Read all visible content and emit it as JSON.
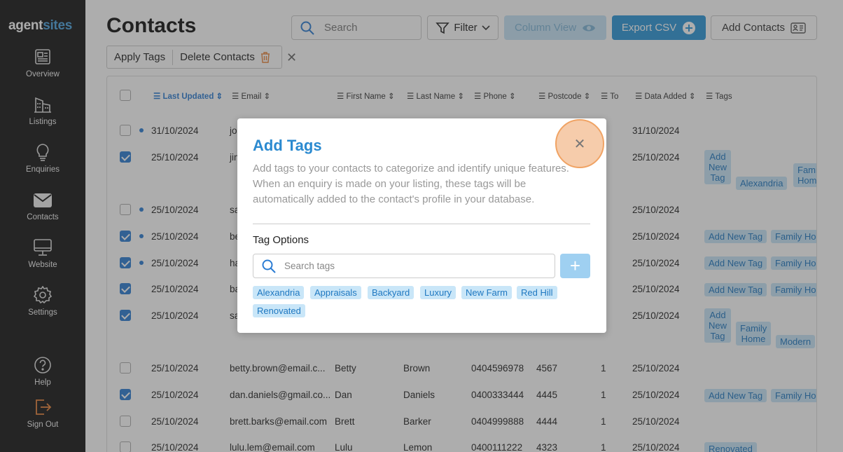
{
  "brand": {
    "part1": "agent",
    "part2": "sites"
  },
  "sidebar": {
    "items": [
      {
        "label": "Overview",
        "icon": "newspaper-icon"
      },
      {
        "label": "Listings",
        "icon": "buildings-icon"
      },
      {
        "label": "Enquiries",
        "icon": "lightbulb-icon"
      },
      {
        "label": "Contacts",
        "icon": "envelope-icon"
      },
      {
        "label": "Website",
        "icon": "monitor-icon"
      },
      {
        "label": "Settings",
        "icon": "gear-icon"
      }
    ],
    "bottom": [
      {
        "label": "Help",
        "icon": "help-icon"
      },
      {
        "label": "Sign Out",
        "icon": "sign-out-icon"
      }
    ]
  },
  "header": {
    "title": "Contacts",
    "search_placeholder": "Search",
    "filter_label": "Filter",
    "column_view_label": "Column View",
    "export_label": "Export CSV",
    "add_contacts_label": "Add Contacts"
  },
  "actions": {
    "apply_tags": "Apply Tags",
    "delete_contacts": "Delete Contacts"
  },
  "table": {
    "columns": [
      "Last Updated",
      "Email",
      "First Name",
      "Last Name",
      "Phone",
      "Postcode",
      "To",
      "Data Added",
      "Tags"
    ],
    "rows": [
      {
        "checked": false,
        "dot": true,
        "updated": "31/10/2024",
        "email": "jo",
        "first": "",
        "last": "",
        "phone": "",
        "postcode": "",
        "to": "",
        "added": "31/10/2024",
        "tags": []
      },
      {
        "checked": true,
        "dot": false,
        "updated": "25/10/2024",
        "email": "jin",
        "first": "",
        "last": "",
        "phone": "",
        "postcode": "",
        "to": "",
        "added": "25/10/2024",
        "tags": [
          "Add New Tag",
          "Alexandria",
          "Family Home"
        ]
      },
      {
        "checked": false,
        "dot": true,
        "updated": "25/10/2024",
        "email": "sa",
        "first": "",
        "last": "",
        "phone": "",
        "postcode": "",
        "to": "",
        "added": "25/10/2024",
        "tags": []
      },
      {
        "checked": true,
        "dot": true,
        "updated": "25/10/2024",
        "email": "be",
        "first": "",
        "last": "",
        "phone": "",
        "postcode": "",
        "to": "",
        "added": "25/10/2024",
        "tags": [
          "Add New Tag",
          "Family Home"
        ]
      },
      {
        "checked": true,
        "dot": true,
        "updated": "25/10/2024",
        "email": "ha",
        "first": "",
        "last": "",
        "phone": "",
        "postcode": "",
        "to": "",
        "added": "25/10/2024",
        "tags": [
          "Add New Tag",
          "Family Home"
        ]
      },
      {
        "checked": true,
        "dot": false,
        "updated": "25/10/2024",
        "email": "ba",
        "first": "",
        "last": "",
        "phone": "",
        "postcode": "",
        "to": "",
        "added": "25/10/2024",
        "tags": [
          "Add New Tag",
          "Family Home"
        ]
      },
      {
        "checked": true,
        "dot": false,
        "updated": "25/10/2024",
        "email": "sa",
        "first": "",
        "last": "",
        "phone": "",
        "postcode": "",
        "to": "",
        "added": "25/10/2024",
        "tags": [
          "Add New Tag",
          "Family Home",
          "Modern"
        ]
      },
      {
        "checked": false,
        "dot": false,
        "updated": "25/10/2024",
        "email": "betty.brown@email.c...",
        "first": "Betty",
        "last": "Brown",
        "phone": "0404596978",
        "postcode": "4567",
        "to": "1",
        "added": "25/10/2024",
        "tags": []
      },
      {
        "checked": true,
        "dot": false,
        "updated": "25/10/2024",
        "email": "dan.daniels@gmail.co...",
        "first": "Dan",
        "last": "Daniels",
        "phone": "0400333444",
        "postcode": "4445",
        "to": "1",
        "added": "25/10/2024",
        "tags": [
          "Add New Tag",
          "Family Home"
        ]
      },
      {
        "checked": false,
        "dot": false,
        "updated": "25/10/2024",
        "email": "brett.barks@email.com",
        "first": "Brett",
        "last": "Barker",
        "phone": "0404999888",
        "postcode": "4444",
        "to": "1",
        "added": "25/10/2024",
        "tags": []
      },
      {
        "checked": false,
        "dot": false,
        "updated": "25/10/2024",
        "email": "lulu.lem@email.com",
        "first": "Lulu",
        "last": "Lemon",
        "phone": "0400111222",
        "postcode": "4323",
        "to": "1",
        "added": "25/10/2024",
        "tags": [
          "Renovated"
        ]
      }
    ]
  },
  "modal": {
    "title": "Add Tags",
    "description": "Add tags to your contacts to categorize and identify unique features. When an enquiry is made on your listing, these tags will be automatically added to the contact's profile in your database.",
    "subtitle": "Tag Options",
    "search_placeholder": "Search tags",
    "add_button": "+",
    "options": [
      "Alexandria",
      "Appraisals",
      "Backyard",
      "Luxury",
      "New Farm",
      "Red Hill",
      "Renovated"
    ]
  }
}
